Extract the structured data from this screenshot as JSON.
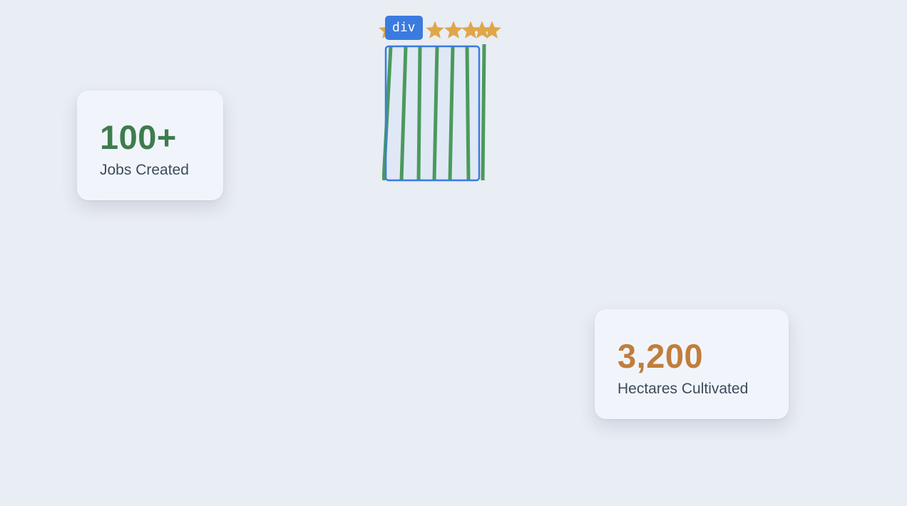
{
  "stats": [
    {
      "value": "100+",
      "label": "Jobs Created",
      "color": "#3e7c4e"
    },
    {
      "value": "3,200",
      "label": "Hectares Cultivated",
      "color": "#c17d3c"
    }
  ],
  "inspector": {
    "tag": "div",
    "highlight_color": "#3b7be0"
  },
  "decoration": {
    "star_icon": "star-icon",
    "star_count": 6,
    "star_color": "#e0a64a",
    "stripe_color": "#4a9a5c"
  },
  "colors": {
    "background": "#e9edf4",
    "card": "#f1f5fb",
    "label": "#3e4a5c"
  }
}
